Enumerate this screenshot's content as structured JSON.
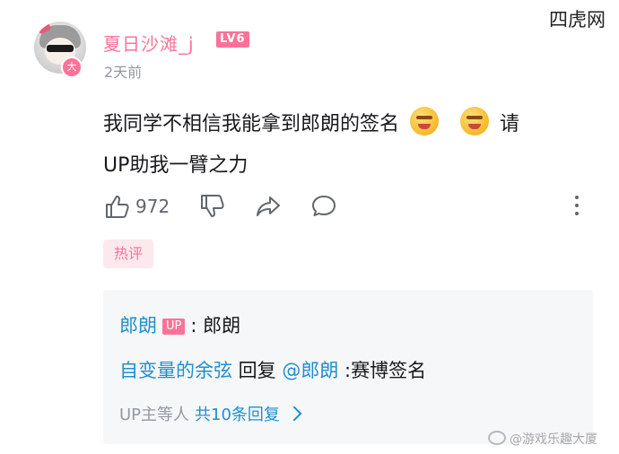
{
  "watermark_top": "四虎网",
  "comment": {
    "username": "夏日沙滩_j",
    "level": "LV6",
    "avatar_badge": "大",
    "time": "2天前",
    "content_part1": "我同学不相信我能拿到郎朗的签名",
    "content_part2": "请",
    "content_part3": "UP助我一臂之力",
    "emoji_name": "angry-face-emoji",
    "like_count": "972"
  },
  "hot_tag": "热评",
  "replies": {
    "reply1": {
      "name": "郎朗",
      "badge": "UP",
      "text": ": 郎朗"
    },
    "reply2": {
      "name": "自变量的余弦",
      "action": " 回复 ",
      "mention": "@郎朗",
      "text": " :赛博签名"
    },
    "summary_prefix": "UP主等人",
    "summary_count": "共10条回复"
  },
  "watermark_bottom": "@游戏乐趣大厦",
  "colors": {
    "accent_pink": "#fb7299",
    "link_blue": "#1f8fcf",
    "muted": "#9499a0"
  },
  "icons": [
    "thumbs-up-icon",
    "thumbs-down-icon",
    "share-icon",
    "comment-icon",
    "more-icon",
    "chevron-right-icon"
  ]
}
